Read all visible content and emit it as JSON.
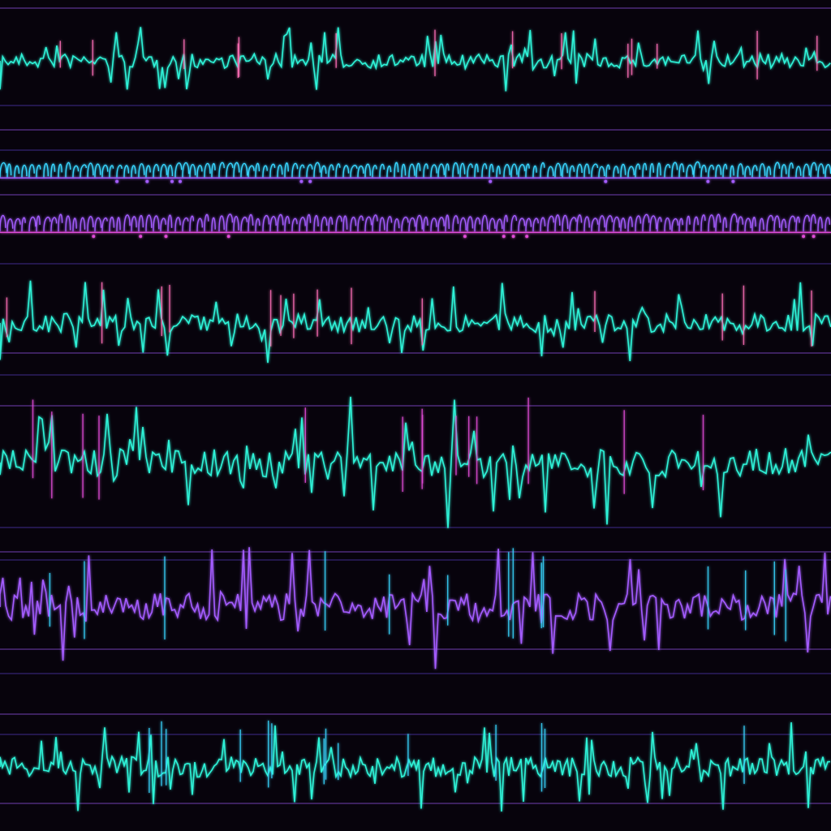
{
  "artwork": {
    "background": "#07030c",
    "palette": {
      "teal": "#2ff3d8",
      "cyan": "#38d6ff",
      "violet": "#a45cff",
      "magenta": "#e04bd6",
      "pink": "#ff6fb7",
      "indigo": "#5a3fc9"
    },
    "bands": [
      {
        "name": "waveform-band-1",
        "kind": "waveform",
        "color": "#2ff3d8",
        "accent": "#ff6fb7",
        "amplitude": 0.55,
        "density": 0.9
      },
      {
        "name": "glyph-band-1",
        "kind": "glyph",
        "color": "#38d6ff",
        "accent": "#a45cff",
        "amplitude": 0.35,
        "density": 1.0
      },
      {
        "name": "glyph-band-2",
        "kind": "glyph",
        "color": "#a45cff",
        "accent": "#e04bd6",
        "amplitude": 0.4,
        "density": 1.0
      },
      {
        "name": "waveform-band-2",
        "kind": "waveform",
        "color": "#2ff3d8",
        "accent": "#ff6fb7",
        "amplitude": 0.7,
        "density": 0.8
      },
      {
        "name": "waveform-band-3",
        "kind": "waveform",
        "color": "#2ff3d8",
        "accent": "#e04bd6",
        "amplitude": 0.85,
        "density": 0.75
      },
      {
        "name": "waveform-band-4",
        "kind": "waveform",
        "color": "#a45cff",
        "accent": "#38d6ff",
        "amplitude": 0.8,
        "density": 0.85
      },
      {
        "name": "waveform-band-5",
        "kind": "waveform",
        "color": "#2ff3d8",
        "accent": "#38d6ff",
        "amplitude": 0.65,
        "density": 1.0
      }
    ]
  }
}
